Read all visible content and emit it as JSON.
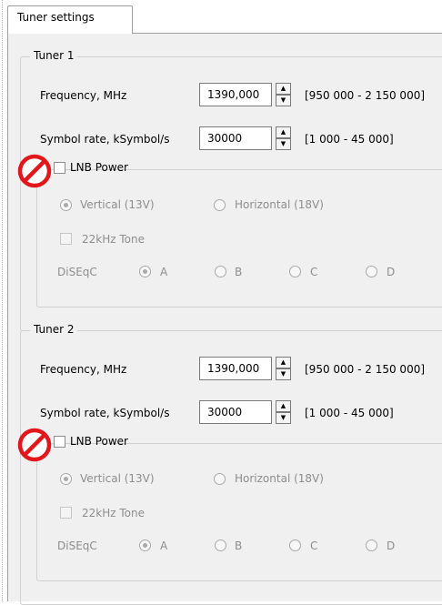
{
  "tab": {
    "label": "Tuner settings"
  },
  "tuners": [
    {
      "title": "Tuner 1",
      "frequency_label": "Frequency, MHz",
      "frequency_value": "1390,000",
      "frequency_range": "[950 000 - 2 150 000]",
      "symbol_rate_label": "Symbol rate, kSymbol/s",
      "symbol_rate_value": "30000",
      "symbol_rate_range": "[1 000 - 45 000]",
      "lnb_power_label": "LNB Power",
      "lnb_power_checked": false,
      "polarization": {
        "vertical": "Vertical (13V)",
        "horizontal": "Horizontal (18V)",
        "selected": "vertical"
      },
      "tone_label": "22kHz Tone",
      "diseqc": {
        "label": "DiSEqC",
        "options": [
          "A",
          "B",
          "C",
          "D"
        ],
        "selected": "A"
      }
    },
    {
      "title": "Tuner 2",
      "frequency_label": "Frequency, MHz",
      "frequency_value": "1390,000",
      "frequency_range": "[950 000 - 2 150 000]",
      "symbol_rate_label": "Symbol rate, kSymbol/s",
      "symbol_rate_value": "30000",
      "symbol_rate_range": "[1 000 - 45 000]",
      "lnb_power_label": "LNB Power",
      "lnb_power_checked": false,
      "polarization": {
        "vertical": "Vertical (13V)",
        "horizontal": "Horizontal (18V)",
        "selected": "vertical"
      },
      "tone_label": "22kHz Tone",
      "diseqc": {
        "label": "DiSEqC",
        "options": [
          "A",
          "B",
          "C",
          "D"
        ],
        "selected": "A"
      }
    }
  ],
  "icons": {
    "disabled_marker": "prohibited-icon",
    "spin_up": "spin-up-icon",
    "spin_down": "spin-down-icon"
  },
  "colors": {
    "disabled_marker": "#e3171b",
    "panel": "#f0f0f0"
  }
}
